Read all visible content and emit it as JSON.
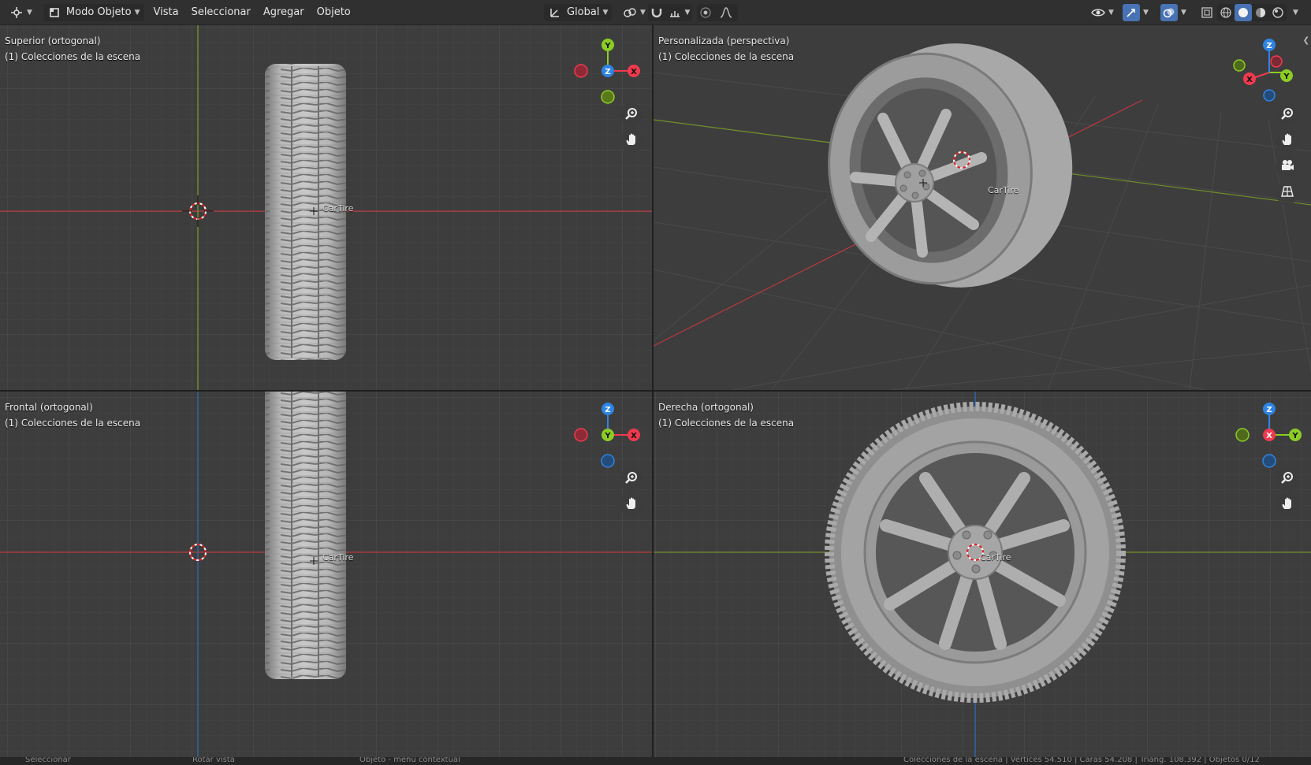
{
  "header": {
    "editor_type_icon": "3d-viewport-icon",
    "mode": "Modo Objeto",
    "menus": [
      "Vista",
      "Seleccionar",
      "Agregar",
      "Objeto"
    ],
    "transform_orientation": "Global"
  },
  "viewports": {
    "top_left": {
      "view": "Superior (ortogonal)",
      "collection": "(1) Colecciones de la escena",
      "object": "CarTire"
    },
    "top_right": {
      "view": "Personalizada (perspectiva)",
      "collection": "(1) Colecciones de la escena",
      "object": "CarTire"
    },
    "bottom_left": {
      "view": "Frontal (ortogonal)",
      "collection": "(1) Colecciones de la escena",
      "object": "CarTire"
    },
    "bottom_right": {
      "view": "Derecha (ortogonal)",
      "collection": "(1) Colecciones de la escena",
      "object": "CarTire"
    }
  },
  "gizmo_axes": {
    "x": "X",
    "y": "Y",
    "z": "Z"
  },
  "colors": {
    "x_axis": "#f03a4f",
    "y_axis": "#8bcc25",
    "z_axis": "#2f84e3",
    "accent": "#4772b3"
  },
  "status_bar": {
    "left": "Seleccionar",
    "middle": "Rotar vista",
    "right": "Objeto - menú contextual",
    "stats": "Colecciones de la escena | Vértices 54.510 | Caras 54.208 | Triáng. 108.392 | Objetos 0/12"
  }
}
